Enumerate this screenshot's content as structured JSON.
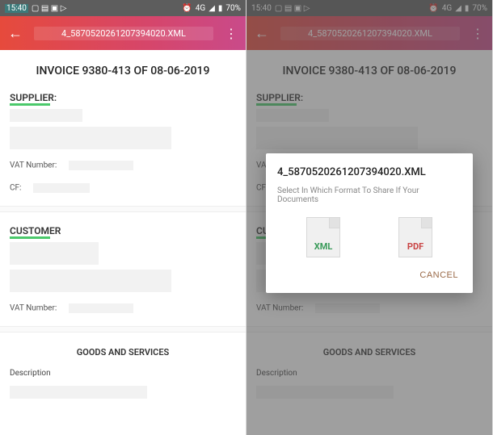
{
  "status": {
    "time": "15:40",
    "network": "4G",
    "battery": "70%"
  },
  "app": {
    "title": "4_587052026120739­4020.XML",
    "back": "←"
  },
  "invoice": {
    "title": "INVOICE 9380-413 OF 08-06-2019",
    "supplier_label": "SUPPLIER:",
    "vat_label": "VAT Number:",
    "cf_label": "CF:",
    "customer_label": "CUSTOMER",
    "goods_label": "GOODS AND SERVICES",
    "desc_label": "Description"
  },
  "dialog": {
    "title": "4_587052026120739­4020.XML",
    "subtitle": "Select In Which Format To Share If Your Documents",
    "xml": "XML",
    "pdf": "PDF",
    "cancel": "CANCEL"
  }
}
